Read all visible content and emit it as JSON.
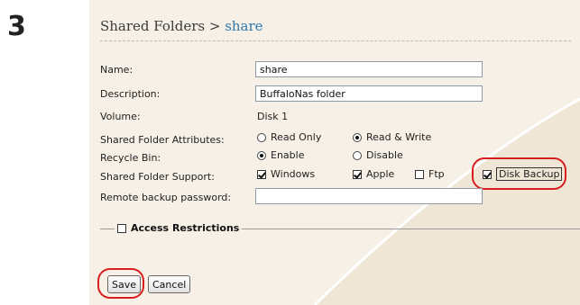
{
  "step_number": "3",
  "header": {
    "section": "Shared Folders",
    "separator": ">",
    "current": "share"
  },
  "form": {
    "name_label": "Name:",
    "name_value": "share",
    "description_label": "Description:",
    "description_value": "BuffaloNas folder",
    "volume_label": "Volume:",
    "volume_value": "Disk 1",
    "attributes_label": "Shared Folder Attributes:",
    "attributes_options": [
      "Read Only",
      "Read & Write"
    ],
    "attributes_selected": "Read & Write",
    "recycle_label": "Recycle Bin:",
    "recycle_options": [
      "Enable",
      "Disable"
    ],
    "recycle_selected": "Enable",
    "support_label": "Shared Folder Support:",
    "support_options": [
      {
        "label": "Windows",
        "checked": true
      },
      {
        "label": "Apple",
        "checked": true
      },
      {
        "label": "Ftp",
        "checked": false
      },
      {
        "label": "Disk Backup",
        "checked": true
      }
    ],
    "remote_backup_label": "Remote backup password:",
    "remote_backup_value": ""
  },
  "access_restrictions": {
    "label": "Access Restrictions",
    "checked": false
  },
  "buttons": {
    "save": "Save",
    "cancel": "Cancel"
  },
  "colors": {
    "panel_bg": "#f6f0e6",
    "link_blue": "#2f78ae",
    "highlight_red": "#d81e1e"
  }
}
